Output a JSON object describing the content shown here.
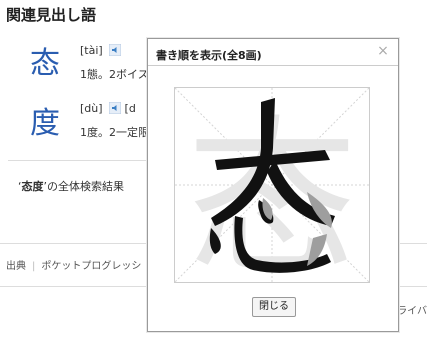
{
  "section": {
    "heading": "関連見出し語"
  },
  "entries": [
    {
      "kanji": "态",
      "reading": "[tài]",
      "extra": "",
      "definition": "1態。2ボイス"
    },
    {
      "kanji": "度",
      "reading": "[dù]",
      "extra": "[d",
      "definition": "1度。2一定限"
    }
  ],
  "search": {
    "term": "态度",
    "suffix": "の全体検索結果"
  },
  "footer": {
    "source_label": "出典",
    "source_name": "ポケットプログレッシ",
    "right_peek": "ライバ"
  },
  "modal": {
    "title": "書き順を表示(全8画)",
    "close_symbol": "×",
    "character": "态",
    "close_button": "閉じる"
  },
  "colors": {
    "link_blue": "#2a5db0",
    "speaker_blue": "#3b7fc4"
  }
}
